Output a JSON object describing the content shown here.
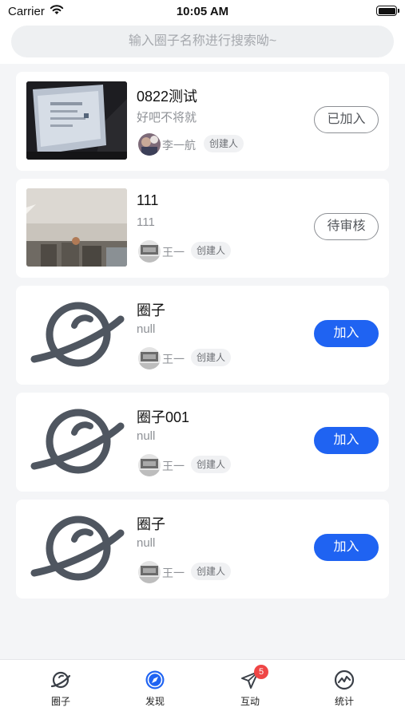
{
  "status_bar": {
    "carrier": "Carrier",
    "time": "10:05 AM"
  },
  "search": {
    "placeholder": "输入圈子名称进行搜索呦~"
  },
  "circles": [
    {
      "title": "0822测试",
      "desc": "好吧不将就",
      "owner": "李一航",
      "role": "创建人",
      "action": "已加入",
      "action_style": "outline",
      "thumb": "photo-screen"
    },
    {
      "title": "111",
      "desc": "111",
      "owner": "王一",
      "role": "创建人",
      "action": "待审核",
      "action_style": "outline",
      "thumb": "photo-room"
    },
    {
      "title": "圈子",
      "desc": "null",
      "owner": "王一",
      "role": "创建人",
      "action": "加入",
      "action_style": "solid",
      "thumb": "planet-logo"
    },
    {
      "title": "圈子001",
      "desc": "null",
      "owner": "王一",
      "role": "创建人",
      "action": "加入",
      "action_style": "solid",
      "thumb": "planet-logo"
    },
    {
      "title": "圈子",
      "desc": "null",
      "owner": "王一",
      "role": "创建人",
      "action": "加入",
      "action_style": "solid",
      "thumb": "planet-logo"
    }
  ],
  "tabbar": {
    "tabs": [
      {
        "label": "圈子",
        "icon": "planet-icon"
      },
      {
        "label": "发现",
        "icon": "compass-icon",
        "active": true
      },
      {
        "label": "互动",
        "icon": "paper-plane-icon",
        "badge": "5"
      },
      {
        "label": "统计",
        "icon": "chart-icon"
      }
    ]
  },
  "colors": {
    "accent": "#1f63f2",
    "badge": "#ef4545",
    "background": "#f4f5f7"
  }
}
